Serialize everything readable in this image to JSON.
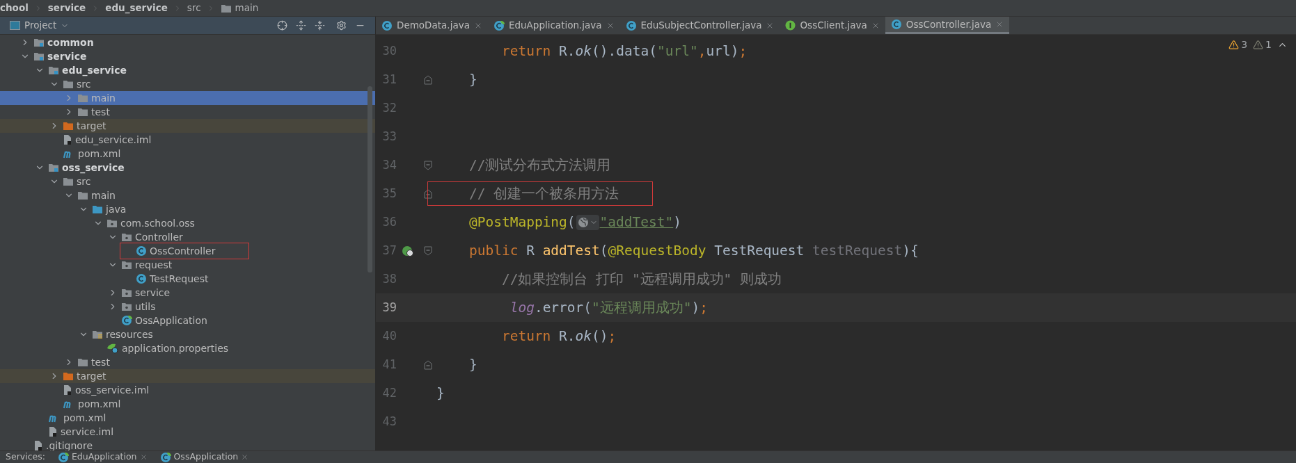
{
  "breadcrumbs": [
    {
      "label": "chool",
      "kind": "module"
    },
    {
      "label": "service",
      "kind": "module"
    },
    {
      "label": "edu_service",
      "kind": "module"
    },
    {
      "label": "src",
      "kind": "plain"
    },
    {
      "label": "main",
      "kind": "folder"
    }
  ],
  "project_panel": {
    "title": "Project",
    "tree": [
      {
        "label": "common",
        "kind": "module",
        "expanded": false,
        "selected": false
      },
      {
        "label": "service",
        "kind": "module",
        "expanded": true,
        "selected": false,
        "children": [
          {
            "label": "edu_service",
            "kind": "module",
            "expanded": true,
            "selected": false,
            "children": [
              {
                "label": "src",
                "kind": "folder",
                "expanded": true,
                "selected": false,
                "children": [
                  {
                    "label": "main",
                    "kind": "folder",
                    "expanded": false,
                    "selected": true
                  },
                  {
                    "label": "test",
                    "kind": "folder",
                    "expanded": false,
                    "selected": false
                  }
                ]
              },
              {
                "label": "target",
                "kind": "excluded",
                "expanded": false,
                "selected": false
              },
              {
                "label": "edu_service.iml",
                "kind": "iml",
                "selected": false
              },
              {
                "label": "pom.xml",
                "kind": "maven",
                "selected": false
              }
            ]
          },
          {
            "label": "oss_service",
            "kind": "module",
            "expanded": true,
            "selected": false,
            "children": [
              {
                "label": "src",
                "kind": "folder",
                "expanded": true,
                "selected": false,
                "children": [
                  {
                    "label": "main",
                    "kind": "folder",
                    "expanded": true,
                    "selected": false,
                    "children": [
                      {
                        "label": "java",
                        "kind": "source-root",
                        "expanded": true,
                        "selected": false,
                        "children": [
                          {
                            "label": "com.school.oss",
                            "kind": "package",
                            "expanded": true,
                            "selected": false,
                            "children": [
                              {
                                "label": "Controller",
                                "kind": "package",
                                "expanded": true,
                                "selected": false,
                                "children": [
                                  {
                                    "label": "OssController",
                                    "kind": "class",
                                    "selected": false,
                                    "outlined": true
                                  }
                                ]
                              },
                              {
                                "label": "request",
                                "kind": "package",
                                "expanded": true,
                                "selected": false,
                                "children": [
                                  {
                                    "label": "TestRequest",
                                    "kind": "class",
                                    "selected": false
                                  }
                                ]
                              },
                              {
                                "label": "service",
                                "kind": "package",
                                "expanded": false,
                                "selected": false
                              },
                              {
                                "label": "utils",
                                "kind": "package",
                                "expanded": false,
                                "selected": false
                              },
                              {
                                "label": "OssApplication",
                                "kind": "app",
                                "selected": false
                              }
                            ]
                          }
                        ]
                      },
                      {
                        "label": "resources",
                        "kind": "resources",
                        "expanded": true,
                        "selected": false,
                        "children": [
                          {
                            "label": "application.properties",
                            "kind": "spring",
                            "selected": false
                          }
                        ]
                      }
                    ]
                  },
                  {
                    "label": "test",
                    "kind": "folder",
                    "expanded": false,
                    "selected": false
                  }
                ]
              },
              {
                "label": "target",
                "kind": "excluded",
                "expanded": false,
                "selected": false
              },
              {
                "label": "oss_service.iml",
                "kind": "iml",
                "selected": false
              },
              {
                "label": "pom.xml",
                "kind": "maven",
                "selected": false
              }
            ]
          },
          {
            "label": "pom.xml",
            "kind": "maven",
            "selected": false
          },
          {
            "label": "service.iml",
            "kind": "iml",
            "selected": false
          }
        ]
      },
      {
        "label": ".gitignore",
        "kind": "gitignore",
        "selected": false
      }
    ]
  },
  "tabs": [
    {
      "label": "DemoData.java",
      "kind": "class",
      "selected": false
    },
    {
      "label": "EduApplication.java",
      "kind": "app",
      "selected": false
    },
    {
      "label": "EduSubjectController.java",
      "kind": "class",
      "selected": false
    },
    {
      "label": "OssClient.java",
      "kind": "interface",
      "selected": false
    },
    {
      "label": "OssController.java",
      "kind": "class",
      "selected": true
    }
  ],
  "inspections": {
    "warnings": "3",
    "weak_warnings": "1"
  },
  "code_lines": [
    {
      "number": "30",
      "current": false,
      "fold_start": false,
      "fold_end": false,
      "endpoint": false,
      "tokens": [
        {
          "kind": "keyword",
          "text": "        return "
        },
        {
          "kind": "plain",
          "text": "R."
        },
        {
          "kind": "static",
          "text": "ok"
        },
        {
          "kind": "plain",
          "text": "().data("
        },
        {
          "kind": "string",
          "text": "\"url\""
        },
        {
          "kind": "keyword",
          "text": ","
        },
        {
          "kind": "plain",
          "text": "url)"
        },
        {
          "kind": "keyword",
          "text": ";"
        }
      ]
    },
    {
      "number": "31",
      "current": false,
      "fold_start": false,
      "fold_end": true,
      "endpoint": false,
      "tokens": [
        {
          "kind": "plain",
          "text": "    }"
        }
      ]
    },
    {
      "number": "32",
      "current": false,
      "fold_start": false,
      "fold_end": false,
      "endpoint": false
    },
    {
      "number": "33",
      "current": false,
      "fold_start": false,
      "fold_end": false,
      "endpoint": false
    },
    {
      "number": "34",
      "current": false,
      "fold_start": true,
      "fold_end": false,
      "endpoint": false,
      "tokens": [
        {
          "kind": "comment",
          "text": "    //测试分布式方法调用"
        }
      ]
    },
    {
      "number": "35",
      "current": false,
      "outlined": true,
      "fold_start": false,
      "fold_end": true,
      "endpoint": false,
      "tokens": [
        {
          "kind": "comment",
          "text": "    // 创建一个被条用方法"
        }
      ]
    },
    {
      "number": "36",
      "current": false,
      "fold_start": false,
      "fold_end": false,
      "endpoint": false,
      "tokens": [
        {
          "kind": "annotation",
          "text": "    @PostMapping"
        },
        {
          "kind": "plain",
          "text": "("
        },
        {
          "kind": "inlay"
        },
        {
          "kind": "url-string",
          "text": "\"addTest\""
        },
        {
          "kind": "plain",
          "text": ")"
        }
      ]
    },
    {
      "number": "37",
      "current": false,
      "fold_start": true,
      "fold_end": false,
      "endpoint": true,
      "tokens": [
        {
          "kind": "keyword",
          "text": "    public "
        },
        {
          "kind": "plain",
          "text": "R "
        },
        {
          "kind": "method",
          "text": "addTest"
        },
        {
          "kind": "plain",
          "text": "("
        },
        {
          "kind": "annotation",
          "text": "@RequestBody "
        },
        {
          "kind": "plain",
          "text": "TestRequest "
        },
        {
          "kind": "unused",
          "text": "testRequest"
        },
        {
          "kind": "plain",
          "text": "){"
        }
      ]
    },
    {
      "number": "38",
      "current": false,
      "fold_start": false,
      "fold_end": false,
      "endpoint": false,
      "tokens": [
        {
          "kind": "comment",
          "text": "        //如果控制台 打印 \"远程调用成功\" 则成功"
        }
      ]
    },
    {
      "number": "39",
      "current": true,
      "fold_start": false,
      "fold_end": false,
      "endpoint": false,
      "tokens": [
        {
          "kind": "field",
          "text": "         log"
        },
        {
          "kind": "plain",
          "text": ".error("
        },
        {
          "kind": "string",
          "text": "\"远程调用成功\""
        },
        {
          "kind": "plain",
          "text": ")"
        },
        {
          "kind": "keyword",
          "text": ";"
        }
      ]
    },
    {
      "number": "40",
      "current": false,
      "fold_start": false,
      "fold_end": false,
      "endpoint": false,
      "tokens": [
        {
          "kind": "keyword",
          "text": "        return "
        },
        {
          "kind": "plain",
          "text": "R."
        },
        {
          "kind": "static",
          "text": "ok"
        },
        {
          "kind": "plain",
          "text": "()"
        },
        {
          "kind": "keyword",
          "text": ";"
        }
      ]
    },
    {
      "number": "41",
      "current": false,
      "fold_start": false,
      "fold_end": true,
      "endpoint": false,
      "tokens": [
        {
          "kind": "plain",
          "text": "    }"
        }
      ]
    },
    {
      "number": "42",
      "current": false,
      "fold_start": false,
      "fold_end": false,
      "endpoint": false,
      "tokens": [
        {
          "kind": "plain",
          "text": "}"
        }
      ]
    },
    {
      "number": "43",
      "current": false,
      "fold_start": false,
      "fold_end": false,
      "endpoint": false
    }
  ],
  "services_bar": {
    "label": "Services:",
    "items": [
      {
        "label": "EduApplication"
      },
      {
        "label": "OssApplication"
      }
    ]
  }
}
